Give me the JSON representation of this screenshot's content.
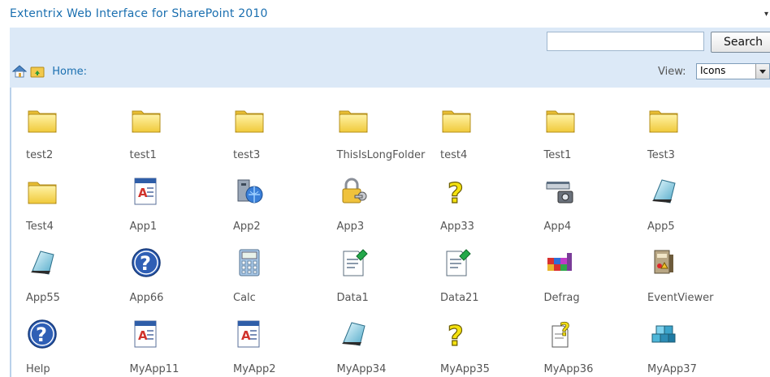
{
  "header": {
    "title": "Extentrix Web Interface for SharePoint 2010"
  },
  "search": {
    "value": "",
    "placeholder": "",
    "button_label": "Search"
  },
  "nav": {
    "home_label": "Home:"
  },
  "view": {
    "label": "View:",
    "selected": "Icons"
  },
  "colors": {
    "link": "#1a6fb0",
    "toolbar_bg": "#dce9f7",
    "folder": "#f6d44f"
  },
  "items": [
    {
      "label": "test2",
      "icon": "folder-icon"
    },
    {
      "label": "test1",
      "icon": "folder-icon"
    },
    {
      "label": "test3",
      "icon": "folder-icon"
    },
    {
      "label": "ThisIsLongFolder",
      "icon": "folder-icon"
    },
    {
      "label": "test4",
      "icon": "folder-icon"
    },
    {
      "label": "Test1",
      "icon": "folder-icon"
    },
    {
      "label": "Test3",
      "icon": "folder-icon"
    },
    {
      "label": "Test4",
      "icon": "folder-icon"
    },
    {
      "label": "App1",
      "icon": "document-app-icon"
    },
    {
      "label": "App2",
      "icon": "computer-globe-icon"
    },
    {
      "label": "App3",
      "icon": "lock-key-icon"
    },
    {
      "label": "App33",
      "icon": "question-icon"
    },
    {
      "label": "App4",
      "icon": "scanner-camera-icon"
    },
    {
      "label": "App5",
      "icon": "notepad-icon"
    },
    {
      "label": "App55",
      "icon": "notepad-icon"
    },
    {
      "label": "App66",
      "icon": "help-icon"
    },
    {
      "label": "Calc",
      "icon": "calculator-icon"
    },
    {
      "label": "Data1",
      "icon": "data-doc-icon"
    },
    {
      "label": "Data21",
      "icon": "data-doc-icon"
    },
    {
      "label": "Defrag",
      "icon": "defrag-icon"
    },
    {
      "label": "EventViewer",
      "icon": "event-viewer-icon"
    },
    {
      "label": "Help",
      "icon": "help-icon"
    },
    {
      "label": "MyApp11",
      "icon": "document-app-icon"
    },
    {
      "label": "MyApp2",
      "icon": "document-app-icon"
    },
    {
      "label": "MyApp34",
      "icon": "notepad-icon"
    },
    {
      "label": "MyApp35",
      "icon": "question-icon"
    },
    {
      "label": "MyApp36",
      "icon": "doc-question-icon"
    },
    {
      "label": "MyApp37",
      "icon": "cubes-icon"
    }
  ]
}
